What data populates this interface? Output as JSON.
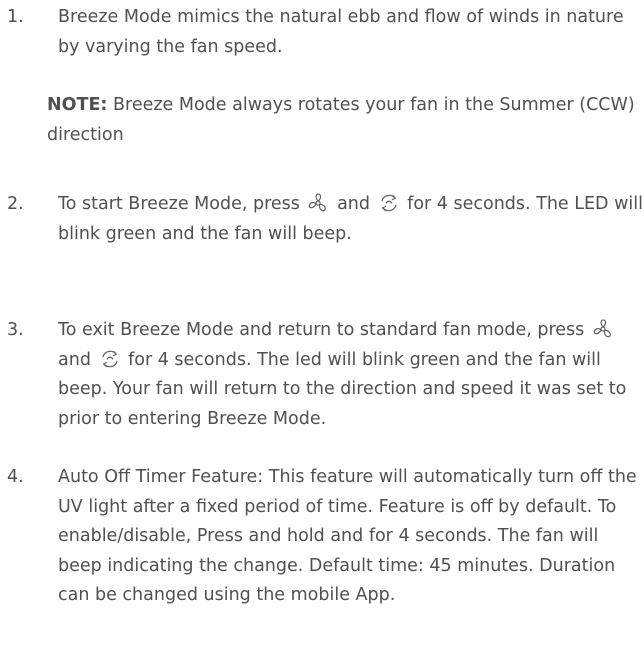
{
  "items": [
    {
      "number": "1.",
      "text": "Breeze Mode mimics the natural ebb and flow of winds in nature by varying the fan speed."
    },
    {
      "number": "2.",
      "text_before": "To start Breeze Mode, press",
      "text_mid": "and",
      "text_after": "for 4 seconds. The LED will blink green and the fan will beep."
    },
    {
      "number": "3.",
      "text_before": "To exit Breeze Mode and return to standard fan mode, press",
      "text_mid": "and",
      "text_after": "for 4 seconds. The led will blink green and the fan will beep. Your fan will return to the direction and speed it was set to prior to entering Breeze Mode."
    },
    {
      "number": "4.",
      "text": "Auto Off Timer Feature: This feature will automatically turn off the UV light after a fixed period of time. Feature is off by default. To enable/disable, Press and hold and for 4 seconds. The fan will beep indicating the change. Default time: 45 minutes. Duration can be changed using the mobile App."
    }
  ],
  "note": {
    "label": "NOTE:",
    "text": "Breeze Mode always rotates your fan in the Summer (CCW) direction"
  },
  "icons": {
    "fan": "fan-icon",
    "direction": "reverse-direction-icon"
  },
  "colors": {
    "text": "#505050"
  }
}
